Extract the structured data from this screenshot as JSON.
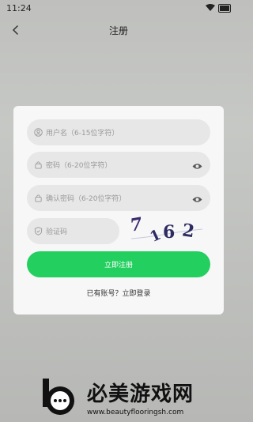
{
  "status": {
    "time": "11:24"
  },
  "header": {
    "title": "注册"
  },
  "form": {
    "username_placeholder": "用户名（6-15位字符）",
    "password_placeholder": "密码（6-20位字符）",
    "confirm_placeholder": "确认密码（6-20位字符）",
    "captcha_placeholder": "验证码",
    "captcha_code": "7 162",
    "register_button": "立即注册",
    "login_prompt": "已有账号？立即登录"
  },
  "icons": {
    "back": "back-arrow-icon",
    "user": "user-icon",
    "lock": "lock-icon",
    "eye": "eye-icon",
    "shield": "shield-icon"
  },
  "colors": {
    "accent": "#23cf5f",
    "card": "#f6f7f6",
    "field": "#e7e7e7"
  },
  "watermark": {
    "title": "必美游戏网",
    "url": "www.beautyflooringsh.com"
  }
}
